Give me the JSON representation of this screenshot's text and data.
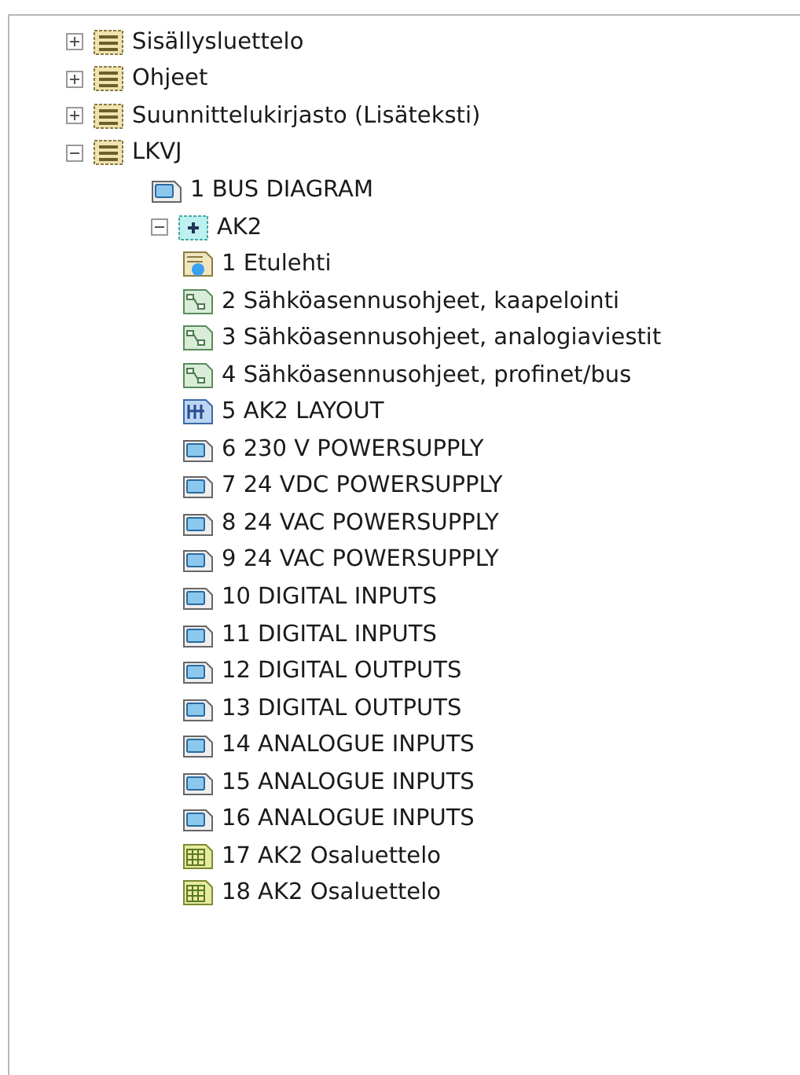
{
  "tree": [
    {
      "label": "Sisällysluettelo",
      "kind": "folder",
      "expanded": false
    },
    {
      "label": "Ohjeet",
      "kind": "folder",
      "expanded": false
    },
    {
      "label": "Suunnittelukirjasto (Lisäteksti)",
      "kind": "folder",
      "expanded": false
    },
    {
      "label": "LKVJ",
      "kind": "folder",
      "expanded": true,
      "children": [
        {
          "label": "1 BUS DIAGRAM",
          "kind": "sheet"
        },
        {
          "label": "AK2",
          "kind": "group",
          "expanded": true,
          "children": [
            {
              "label": "1 Etulehti",
              "kind": "cover"
            },
            {
              "label": "2 Sähköasennusohjeet, kaapelointi",
              "kind": "schematic"
            },
            {
              "label": "3 Sähköasennusohjeet, analogiaviestit",
              "kind": "schematic"
            },
            {
              "label": "4 Sähköasennusohjeet, profinet/bus",
              "kind": "schematic"
            },
            {
              "label": "5 AK2 LAYOUT",
              "kind": "layout"
            },
            {
              "label": "6 230 V POWERSUPPLY",
              "kind": "sheet"
            },
            {
              "label": "7 24 VDC POWERSUPPLY",
              "kind": "sheet"
            },
            {
              "label": "8 24 VAC POWERSUPPLY",
              "kind": "sheet"
            },
            {
              "label": "9 24 VAC POWERSUPPLY",
              "kind": "sheet"
            },
            {
              "label": "10 DIGITAL INPUTS",
              "kind": "sheet"
            },
            {
              "label": "11 DIGITAL INPUTS",
              "kind": "sheet"
            },
            {
              "label": "12 DIGITAL OUTPUTS",
              "kind": "sheet"
            },
            {
              "label": "13 DIGITAL OUTPUTS",
              "kind": "sheet"
            },
            {
              "label": "14 ANALOGUE INPUTS",
              "kind": "sheet"
            },
            {
              "label": "15 ANALOGUE INPUTS",
              "kind": "sheet"
            },
            {
              "label": "16 ANALOGUE INPUTS",
              "kind": "sheet"
            },
            {
              "label": "17 AK2 Osaluettelo",
              "kind": "table"
            },
            {
              "label": "18 AK2 Osaluettelo",
              "kind": "table"
            }
          ]
        }
      ]
    }
  ]
}
